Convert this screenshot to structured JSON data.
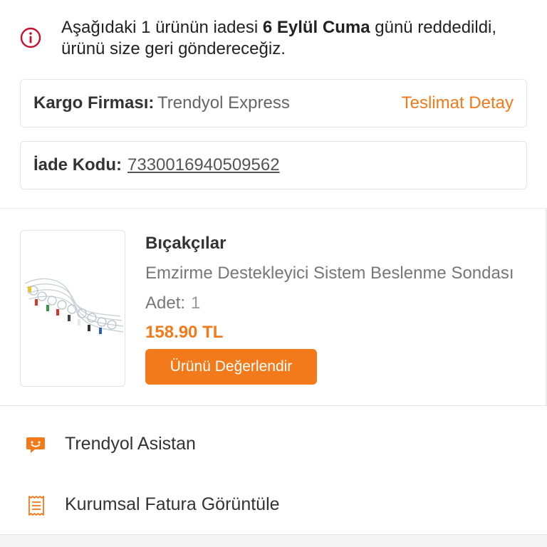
{
  "alert": {
    "text_part1": "Aşağıdaki 1 ürünün iadesi ",
    "text_bold": "6 Eylül Cuma",
    "text_part2": " günü reddedildi, ürünü size geri göndereceğiz.",
    "icon": "info-circle-icon",
    "color": "#c8102e"
  },
  "shipping": {
    "label": "Kargo Firması:",
    "company": "Trendyol Express",
    "detail_link": "Teslimat Detay"
  },
  "return": {
    "label": "İade Kodu:",
    "code": "7330016940509562"
  },
  "product": {
    "seller": "Bıçakçılar",
    "name": "Emzirme Destekleyici Sistem Beslenme Sondası",
    "qty_label": "Adet:",
    "qty_value": "1",
    "price": "158.90 TL",
    "rate_button": "Ürünü Değerlendir"
  },
  "menu": {
    "items": [
      {
        "label": "Trendyol Asistan",
        "icon": "chat-bubble-icon"
      },
      {
        "label": "Kurumsal Fatura Görüntüle",
        "icon": "receipt-icon"
      }
    ]
  },
  "colors": {
    "accent": "#f27a1a",
    "alert": "#c8102e",
    "border": "#e6e6e6"
  }
}
